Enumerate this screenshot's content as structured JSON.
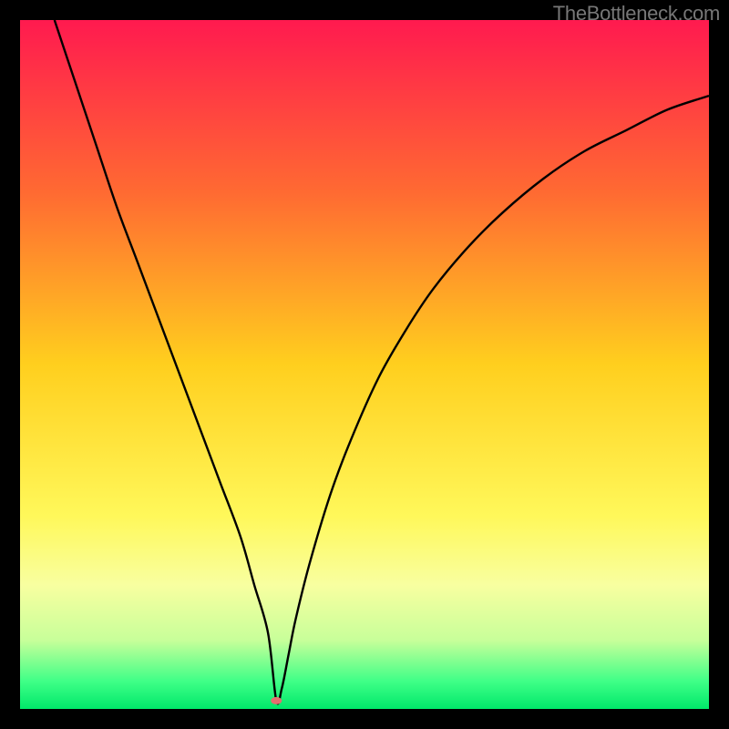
{
  "watermark": "TheBottleneck.com",
  "chart_data": {
    "type": "line",
    "title": "",
    "xlabel": "",
    "ylabel": "",
    "xlim": [
      0,
      100
    ],
    "ylim": [
      0,
      100
    ],
    "background": {
      "type": "vertical_gradient",
      "stops": [
        {
          "offset": 0,
          "color": "#ff1a4f"
        },
        {
          "offset": 25,
          "color": "#ff6a32"
        },
        {
          "offset": 50,
          "color": "#ffcf1e"
        },
        {
          "offset": 72,
          "color": "#fff85a"
        },
        {
          "offset": 82,
          "color": "#f8ffa0"
        },
        {
          "offset": 90,
          "color": "#c8ff9a"
        },
        {
          "offset": 96,
          "color": "#3fff87"
        },
        {
          "offset": 100,
          "color": "#00e86a"
        }
      ]
    },
    "curve_color": "#000000",
    "curve_width": 2.4,
    "series": [
      {
        "name": "bottleneck-curve",
        "x": [
          5,
          8,
          11,
          14,
          17,
          20,
          23,
          26,
          29,
          32,
          34,
          36,
          37.2,
          38,
          39,
          40,
          42,
          45,
          48,
          52,
          56,
          60,
          65,
          70,
          76,
          82,
          88,
          94,
          100
        ],
        "y": [
          100,
          91,
          82,
          73,
          65,
          57,
          49,
          41,
          33,
          25,
          18,
          11,
          1.2,
          3,
          8,
          13,
          21,
          31,
          39,
          48,
          55,
          61,
          67,
          72,
          77,
          81,
          84,
          87,
          89
        ]
      }
    ],
    "marker": {
      "name": "optimum-point",
      "x": 37.2,
      "y": 1.2,
      "rx": 6,
      "ry": 4,
      "color": "#e46f6f"
    }
  }
}
